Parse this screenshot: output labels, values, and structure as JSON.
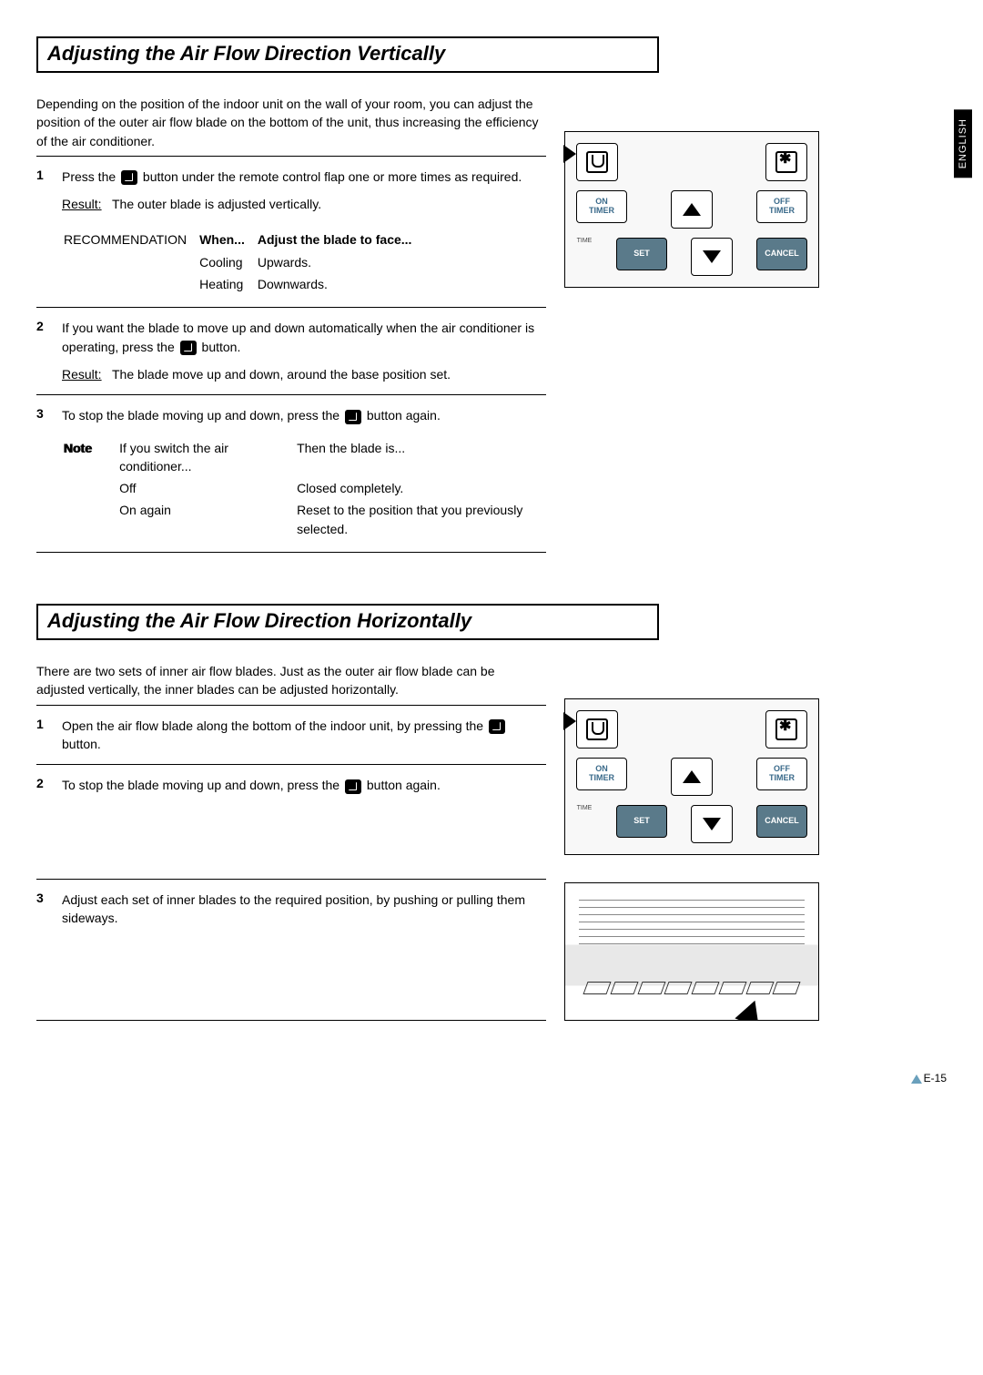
{
  "language_tab": "ENGLISH",
  "section1": {
    "title": "Adjusting the Air Flow Direction Vertically",
    "intro": "Depending on the position of the indoor unit on the wall of your room, you can adjust the position of the outer air flow blade on the bottom of the unit, thus increasing the efficiency of the air conditioner.",
    "step1": {
      "num": "1",
      "text_a": "Press the ",
      "text_b": " button under the remote control flap one or more times as required.",
      "result_label": "Result:",
      "result_text": "The outer blade is adjusted vertically.",
      "rec_label": "RECOMMENDATION",
      "rec_h1": "When...",
      "rec_h2": "Adjust the blade to face...",
      "rec_r1c1": "Cooling",
      "rec_r1c2": "Upwards.",
      "rec_r2c1": "Heating",
      "rec_r2c2": "Downwards."
    },
    "step2": {
      "num": "2",
      "text_a": "If you want the blade to move up and down automatically when the air conditioner is operating, press the ",
      "text_b": " button.",
      "result_label": "Result:",
      "result_text": "The blade move up and down, around the base position set."
    },
    "step3": {
      "num": "3",
      "text_a": "To stop the blade moving up and down, press the ",
      "text_b": " button again.",
      "note_label": "Note",
      "note_h1": "If you switch the air conditioner...",
      "note_h2": "Then the blade is...",
      "note_r1c1": "Off",
      "note_r1c2": "Closed completely.",
      "note_r2c1": "On again",
      "note_r2c2": "Reset to the position that you previously selected."
    }
  },
  "section2": {
    "title": "Adjusting the Air Flow Direction Horizontally",
    "intro": "There are two sets of inner air flow blades. Just as the outer air flow blade can be adjusted vertically, the inner blades can be adjusted horizontally.",
    "step1": {
      "num": "1",
      "text_a": "Open the air flow blade along the bottom of the indoor unit, by pressing the ",
      "text_b": " button."
    },
    "step2": {
      "num": "2",
      "text_a": "To stop the blade moving up and down, press the ",
      "text_b": " button again."
    },
    "step3": {
      "num": "3",
      "text": "Adjust each set of inner blades to the required position, by pushing or pulling them sideways."
    }
  },
  "remote": {
    "on_timer": "ON\nTIMER",
    "off_timer": "OFF\nTIMER",
    "set": "SET",
    "cancel": "CANCEL",
    "time": "TIME"
  },
  "page_prefix": "E-",
  "page_number": "15"
}
